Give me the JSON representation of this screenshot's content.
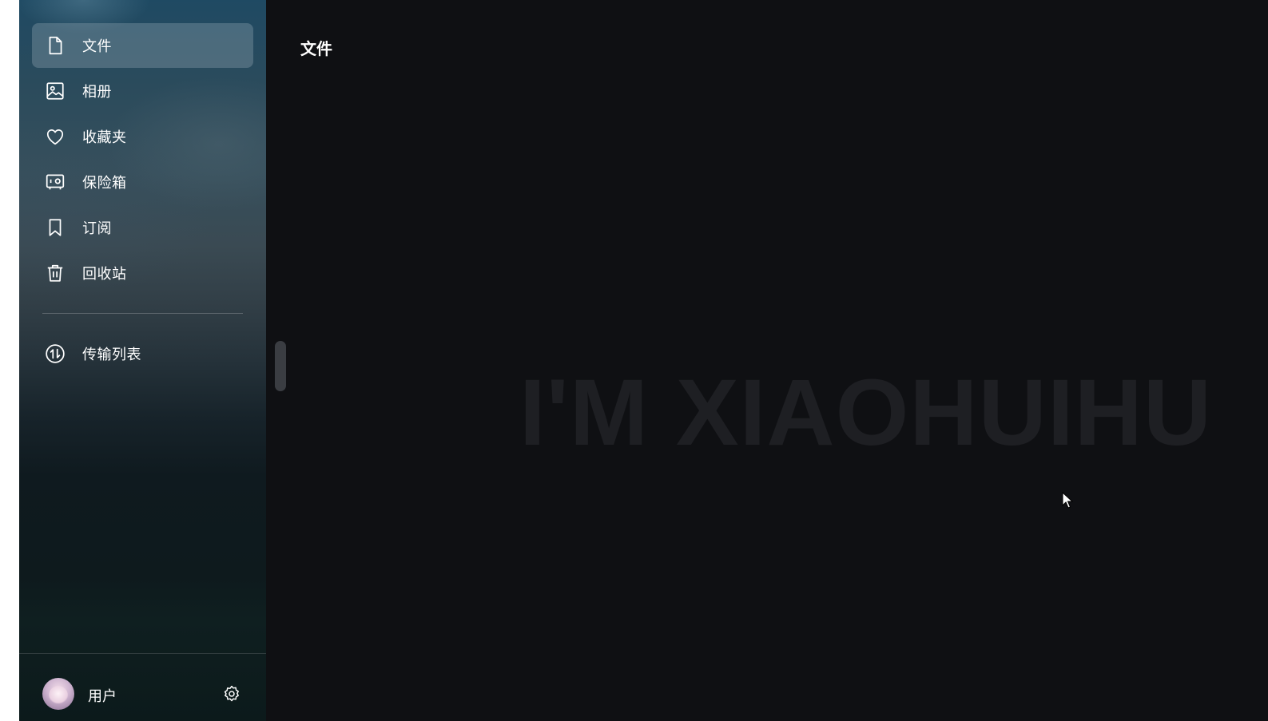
{
  "sidebar": {
    "items": [
      {
        "label": "文件",
        "icon": "file-icon",
        "active": true
      },
      {
        "label": "相册",
        "icon": "image-icon",
        "active": false
      },
      {
        "label": "收藏夹",
        "icon": "heart-icon",
        "active": false
      },
      {
        "label": "保险箱",
        "icon": "safe-icon",
        "active": false
      },
      {
        "label": "订阅",
        "icon": "bookmark-icon",
        "active": false
      },
      {
        "label": "回收站",
        "icon": "trash-icon",
        "active": false
      }
    ],
    "transfer": {
      "label": "传输列表",
      "icon": "transfer-icon"
    },
    "user": {
      "name": "用户",
      "avatar": "avatar-image",
      "settings_icon": "settings-icon"
    }
  },
  "main": {
    "title": "文件",
    "watermark": "I'M XIAOHUIHU"
  },
  "colors": {
    "background": "#0f1013",
    "active_item": "#6b7f89",
    "text": "#ffffff",
    "watermark": "#1e1f23"
  }
}
